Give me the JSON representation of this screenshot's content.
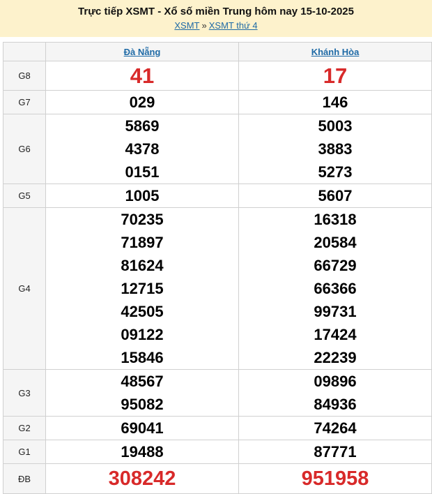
{
  "header": {
    "title": "Trực tiếp XSMT - Xổ số miền Trung hôm nay 15-10-2025",
    "breadcrumb": [
      {
        "label": "XSMT"
      },
      {
        "label": "XSMT thứ 4"
      }
    ],
    "separator": "»"
  },
  "table": {
    "provinces": [
      "Đà Nẵng",
      "Khánh Hòa"
    ],
    "rows": [
      {
        "prize": "G8",
        "values": [
          [
            "41"
          ],
          [
            "17"
          ]
        ]
      },
      {
        "prize": "G7",
        "values": [
          [
            "029"
          ],
          [
            "146"
          ]
        ]
      },
      {
        "prize": "G6",
        "values": [
          [
            "5869",
            "4378",
            "0151"
          ],
          [
            "5003",
            "3883",
            "5273"
          ]
        ]
      },
      {
        "prize": "G5",
        "values": [
          [
            "1005"
          ],
          [
            "5607"
          ]
        ]
      },
      {
        "prize": "G4",
        "values": [
          [
            "70235",
            "71897",
            "81624",
            "12715",
            "42505",
            "09122",
            "15846"
          ],
          [
            "16318",
            "20584",
            "66729",
            "66366",
            "99731",
            "17424",
            "22239"
          ]
        ]
      },
      {
        "prize": "G3",
        "values": [
          [
            "48567",
            "95082"
          ],
          [
            "09896",
            "84936"
          ]
        ]
      },
      {
        "prize": "G2",
        "values": [
          [
            "69041"
          ],
          [
            "74264"
          ]
        ]
      },
      {
        "prize": "G1",
        "values": [
          [
            "19488"
          ],
          [
            "87771"
          ]
        ]
      },
      {
        "prize": "ĐB",
        "values": [
          [
            "308242"
          ],
          [
            "951958"
          ]
        ]
      }
    ]
  },
  "colors": {
    "header_bg": "#fdf2cc",
    "link": "#1e6aa6",
    "highlight_red": "#d82a2a",
    "label_bg": "#f5f5f5"
  }
}
